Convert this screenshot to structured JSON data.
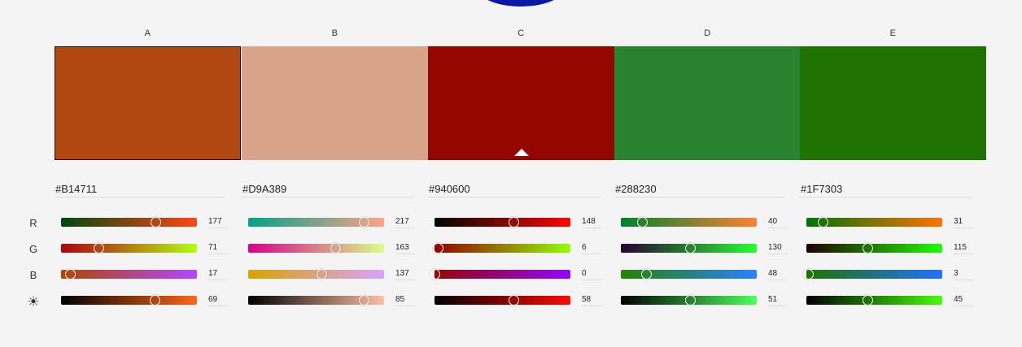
{
  "columns": [
    {
      "label": "A",
      "hex": "#B14711",
      "color": "#B14711",
      "selected": true,
      "channels": [
        {
          "key": "R",
          "value": "177",
          "fraction": 0.694,
          "gradient": "linear-gradient(90deg,#004711,#ff4711)"
        },
        {
          "key": "G",
          "value": "71",
          "fraction": 0.278,
          "gradient": "linear-gradient(90deg,#b10011,#b1ff11)"
        },
        {
          "key": "B",
          "value": "17",
          "fraction": 0.067,
          "gradient": "linear-gradient(90deg,#b14700,#b147ff)"
        },
        {
          "key": "L",
          "value": "69",
          "fraction": 0.69,
          "gradient": "linear-gradient(90deg,#000000,#ff6618)"
        }
      ]
    },
    {
      "label": "B",
      "hex": "#D9A389",
      "color": "#D9A389",
      "selected": false,
      "channels": [
        {
          "key": "R",
          "value": "217",
          "fraction": 0.851,
          "gradient": "linear-gradient(90deg,#00a389,#ffa389)"
        },
        {
          "key": "G",
          "value": "163",
          "fraction": 0.639,
          "gradient": "linear-gradient(90deg,#d90089,#d9ff89)"
        },
        {
          "key": "B",
          "value": "137",
          "fraction": 0.537,
          "gradient": "linear-gradient(90deg,#d9a300,#d9a3ff)"
        },
        {
          "key": "L",
          "value": "85",
          "fraction": 0.85,
          "gradient": "linear-gradient(90deg,#000000,#ffc0a1)"
        }
      ]
    },
    {
      "label": "C",
      "hex": "#940600",
      "color": "#940600",
      "selected": false,
      "caret": true,
      "channels": [
        {
          "key": "R",
          "value": "148",
          "fraction": 0.58,
          "gradient": "linear-gradient(90deg,#000600,#ff0600)"
        },
        {
          "key": "G",
          "value": "6",
          "fraction": 0.024,
          "gradient": "linear-gradient(90deg,#940000,#94ff00)"
        },
        {
          "key": "B",
          "value": "0",
          "fraction": 0.0,
          "gradient": "linear-gradient(90deg,#940600,#9406ff)"
        },
        {
          "key": "L",
          "value": "58",
          "fraction": 0.58,
          "gradient": "linear-gradient(90deg,#000000,#ff0a00)"
        }
      ]
    },
    {
      "label": "D",
      "hex": "#288230",
      "color": "#288230",
      "selected": false,
      "channels": [
        {
          "key": "R",
          "value": "40",
          "fraction": 0.157,
          "gradient": "linear-gradient(90deg,#008230,#ff8230)"
        },
        {
          "key": "G",
          "value": "130",
          "fraction": 0.51,
          "gradient": "linear-gradient(90deg,#280030,#28ff30)"
        },
        {
          "key": "B",
          "value": "48",
          "fraction": 0.188,
          "gradient": "linear-gradient(90deg,#288200,#2882ff)"
        },
        {
          "key": "L",
          "value": "51",
          "fraction": 0.51,
          "gradient": "linear-gradient(90deg,#000000,#4eff5e)"
        }
      ]
    },
    {
      "label": "E",
      "hex": "#1F7303",
      "color": "#1F7303",
      "selected": false,
      "channels": [
        {
          "key": "R",
          "value": "31",
          "fraction": 0.122,
          "gradient": "linear-gradient(90deg,#007303,#ff7303)"
        },
        {
          "key": "G",
          "value": "115",
          "fraction": 0.451,
          "gradient": "linear-gradient(90deg,#1f0003,#1fff03)"
        },
        {
          "key": "B",
          "value": "3",
          "fraction": 0.012,
          "gradient": "linear-gradient(90deg,#1f7300,#1f73ff)"
        },
        {
          "key": "L",
          "value": "45",
          "fraction": 0.45,
          "gradient": "linear-gradient(90deg,#000000,#45ff07)"
        }
      ]
    }
  ],
  "row_labels": [
    {
      "label": "R"
    },
    {
      "label": "G"
    },
    {
      "label": "B"
    },
    {
      "label": "☀",
      "icon": "brightness-icon"
    }
  ]
}
